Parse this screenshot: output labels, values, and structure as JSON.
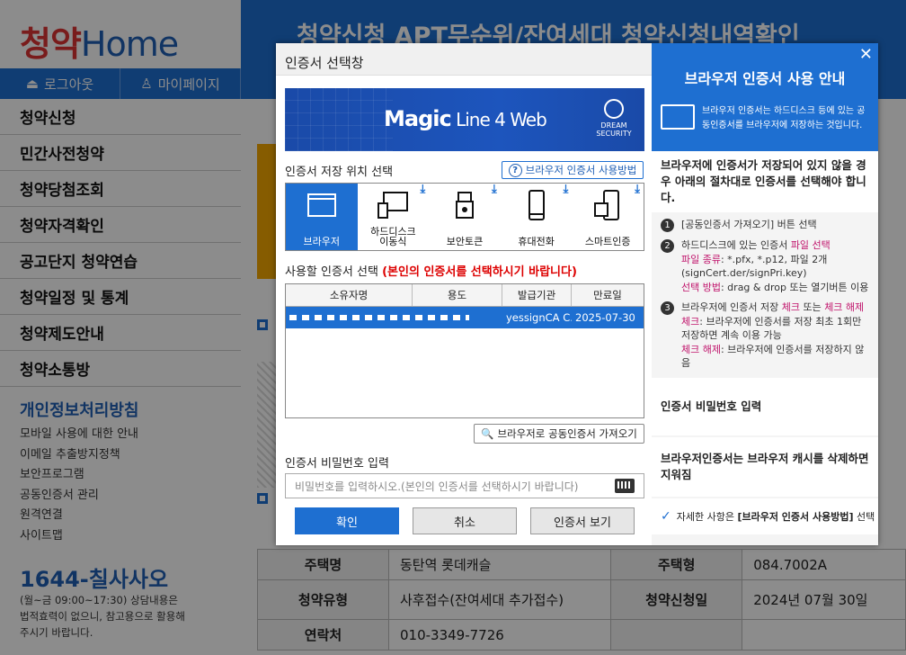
{
  "site": {
    "logo_a": "청약",
    "logo_b": "Home",
    "logout": "로그아웃",
    "mypage": "마이페이지",
    "menu": [
      "청약신청",
      "민간사전청약",
      "청약당첨조회",
      "청약자격확인",
      "공고단지 청약연습",
      "청약일정 및 통계",
      "청약제도안내",
      "청약소통방"
    ],
    "policy": "개인정보처리방침",
    "sub": [
      "모바일 사용에 대한 안내",
      "이메일 추출방지정책",
      "보안프로그램",
      "공동인증서 관리",
      "원격연결",
      "사이트맵"
    ],
    "phone": "1644-칠사사오",
    "hours": [
      "(월~금 09:00~17:30) 상담내용은",
      "법적효력이 없으니, 참고용으로 활용해",
      "주시기 바랍니다."
    ],
    "hero_title": "청약신청  APT무순위/잔여세대  청약신청내역확인",
    "table": [
      {
        "h1": "주택명",
        "v1": "동탄역 롯데캐슬",
        "h2": "주택형",
        "v2": "084.7002A"
      },
      {
        "h1": "청약유형",
        "v1": "사후접수(잔여세대 추가접수)",
        "h2": "청약신청일",
        "v2": "2024년 07월 30일"
      },
      {
        "h1": "연락처",
        "v1": "010-3349-7726",
        "h2": "",
        "v2": ""
      }
    ]
  },
  "modal": {
    "title": "인증서 선택창",
    "banner_product": "Magic",
    "banner_product2": " Line 4 Web",
    "banner_vendor1": "DREAM",
    "banner_vendor2": "SECURITY",
    "storage_label": "인증서 저장 위치 선택",
    "help_button": "브라우저 인증서 사용방법",
    "storage_options": [
      "브라우저",
      "하드디스크\n이동식",
      "보안토큰",
      "휴대전화",
      "스마트인증"
    ],
    "select_label": "사용할 인증서 선택",
    "select_warning": "(본인의 인증서를 선택하시기 바랍니다)",
    "columns": [
      "소유자명",
      "용도",
      "발급기관",
      "만료일"
    ],
    "cert_row": {
      "owner": "",
      "usage": "",
      "issuer": "yessignCA C...",
      "expiry": "2025-07-30"
    },
    "import_button": "브라우저로 공동인증서 가져오기",
    "password_label": "인증서 비밀번호 입력",
    "password_placeholder": "비밀번호를 입력하시오.(본인의 인증서를 선택하시기 바랍니다)",
    "ok": "확인",
    "cancel": "취소",
    "view": "인증서 보기"
  },
  "guide": {
    "title": "브라우저 인증서 사용 안내",
    "desc": "브라우저 인증서는 하드디스크 등에 있는 공동인증서를 브라우저에 저장하는 것입니다.",
    "intro": "브라우저에 인증서가 저장되어 있지 않을 경우 아래의 절차대로 인증서를 선택해야 합니다.",
    "step1": "[공동인증서 가져오기] 버튼 선택",
    "step2a": "하드디스크에 있는 인증서 ",
    "step2b": "파일 선택",
    "step2c": "파일 종류",
    "step2d": ": *.pfx, *.p12, 파일 2개 (signCert.der/signPri.key)",
    "step2e": "선택 방법",
    "step2f": ": drag & drop 또는 열기버튼 이용",
    "step3a": "브라우저에 인증서 저장 ",
    "step3b": "체크",
    "step3c": " 또는 ",
    "step3d": "체크 해제",
    "step3e": "체크",
    "step3f": ": 브라우저에 인증서를 저장 최초 1회만 저장하면 계속 이용 가능",
    "step3g": "체크 해제",
    "step3h": ": 브라우저에 인증서를 저장하지 않음",
    "pw_section": "인증서 비밀번호 입력",
    "cache_section": "브라우저인증서는 브라우저 캐시를 삭제하면 지워짐",
    "footer_a": "자세한 사항은 ",
    "footer_b": "[브라우저 인증서 사용방법]",
    "footer_c": " 선택",
    "colors": {
      "accent": "#1e6fd1",
      "pink": "#c0136b",
      "warn": "#dd0000"
    }
  }
}
